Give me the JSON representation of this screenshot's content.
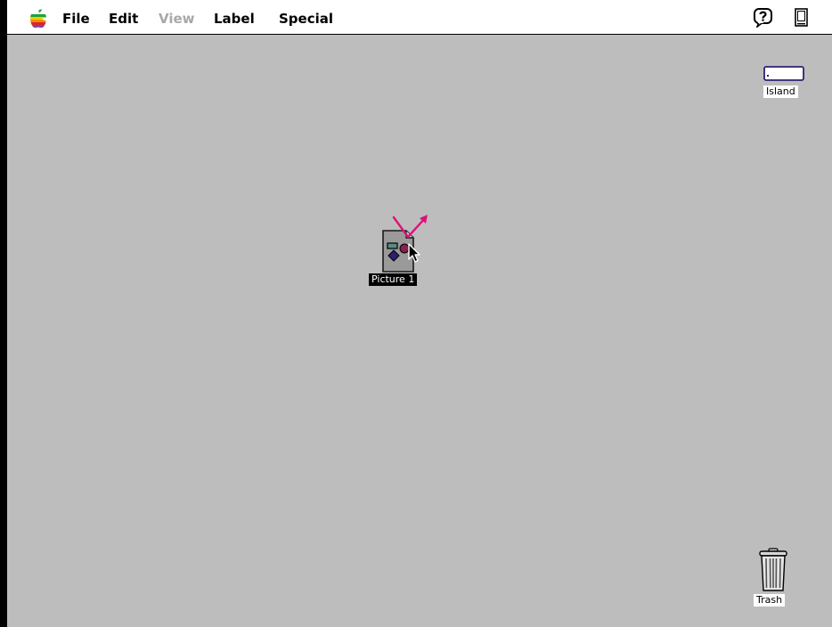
{
  "menubar": {
    "items": [
      {
        "label": "File",
        "enabled": true
      },
      {
        "label": "Edit",
        "enabled": true
      },
      {
        "label": "View",
        "enabled": false
      },
      {
        "label": "Label",
        "enabled": true
      },
      {
        "label": "Special",
        "enabled": true
      }
    ],
    "apple_icon": "apple-rainbow-icon",
    "help_icon": "balloon-help-icon",
    "app_icon": "finder-app-icon"
  },
  "desktop": {
    "background_color": "#bdbdbd",
    "icons": {
      "island": {
        "label": "Island",
        "icon": "hard-disk-icon"
      },
      "picture": {
        "label": "Picture 1",
        "icon": "picture-document-icon",
        "selected": true
      },
      "trash": {
        "label": "Trash",
        "icon": "trash-icon"
      }
    },
    "annotation": {
      "icon": "drag-arrows-icon",
      "color": "#e0107a"
    },
    "cursor": "arrow-pointer-icon"
  }
}
